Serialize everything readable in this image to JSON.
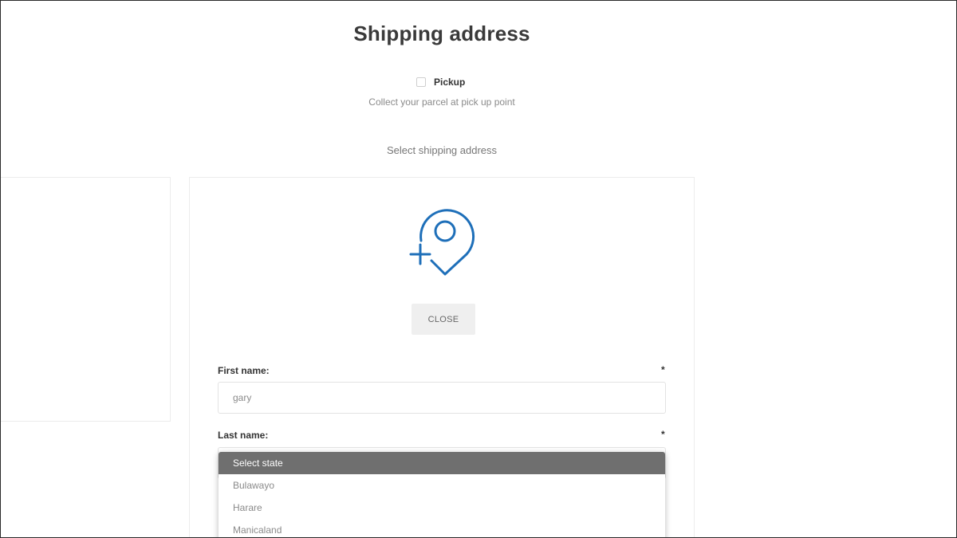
{
  "page": {
    "title": "Shipping address"
  },
  "pickup": {
    "label": "Pickup",
    "checked": false,
    "description": "Collect your parcel at pick up point"
  },
  "address_selector": {
    "label": "Select shipping address"
  },
  "new_address_card": {
    "icon": "map-pin-plus-icon",
    "icon_color": "#1e6fb9",
    "close_label": "CLOSE"
  },
  "form": {
    "first_name": {
      "label": "First name:",
      "required_mark": "*",
      "value": "gary"
    },
    "last_name": {
      "label": "Last name:",
      "required_mark": "*",
      "value": ""
    }
  },
  "state_dropdown": {
    "selected": "Select state",
    "options": [
      "Select state",
      "Bulawayo",
      "Harare",
      "Manicaland"
    ]
  },
  "colors": {
    "accent": "#1e6fb9",
    "dropdown_highlight": "#6f6f6f"
  }
}
